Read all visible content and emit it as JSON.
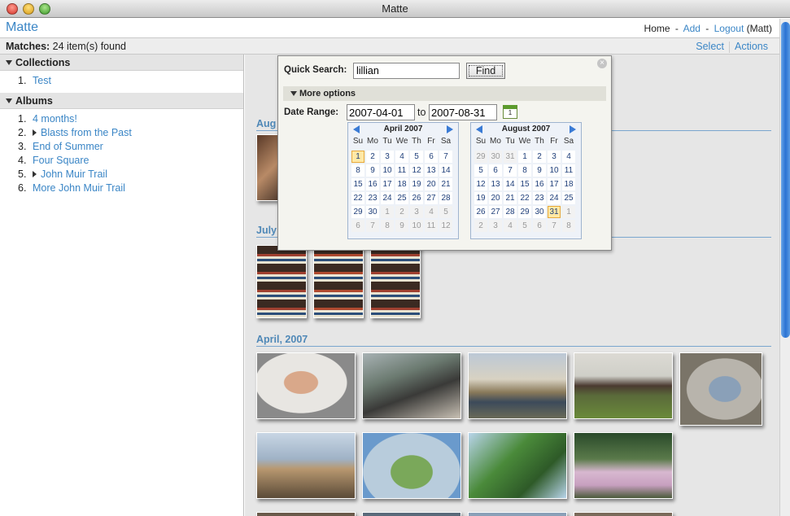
{
  "window": {
    "title": "Matte"
  },
  "app": {
    "title": "Matte"
  },
  "topnav": {
    "home": "Home",
    "sep": "-",
    "add": "Add",
    "logout": "Logout",
    "user": "(Matt)"
  },
  "matches": {
    "label": "Matches:",
    "count_text": "24 item(s) found",
    "select": "Select",
    "actions": "Actions"
  },
  "sidebar": {
    "collections": {
      "title": "Collections",
      "items": [
        {
          "num": "1.",
          "label": "Test"
        }
      ]
    },
    "albums": {
      "title": "Albums",
      "items": [
        {
          "num": "1.",
          "label": "4 months!"
        },
        {
          "num": "2.",
          "label": "Blasts from the Past"
        },
        {
          "num": "3.",
          "label": "End of Summer"
        },
        {
          "num": "4.",
          "label": "Four Square"
        },
        {
          "num": "5.",
          "label": "John Muir Trail"
        },
        {
          "num": "6.",
          "label": "More John Muir Trail"
        }
      ]
    }
  },
  "groups": {
    "august": "Aug",
    "july": "July",
    "april": "April, 2007"
  },
  "search": {
    "quick_label": "Quick Search:",
    "query": "lillian",
    "find_label": "Find",
    "more_options": "More options",
    "date_range_label": "Date Range:",
    "date_from": "2007-04-01",
    "to_label": "to",
    "date_to": "2007-08-31",
    "calendar_icon": "calendar-icon",
    "close_icon": "close-icon"
  },
  "calendars": [
    {
      "title": "April 2007",
      "dow": [
        "Su",
        "Mo",
        "Tu",
        "We",
        "Th",
        "Fr",
        "Sa"
      ],
      "weeks": [
        [
          "1",
          "2",
          "3",
          "4",
          "5",
          "6",
          "7"
        ],
        [
          "8",
          "9",
          "10",
          "11",
          "12",
          "13",
          "14"
        ],
        [
          "15",
          "16",
          "17",
          "18",
          "19",
          "20",
          "21"
        ],
        [
          "22",
          "23",
          "24",
          "25",
          "26",
          "27",
          "28"
        ],
        [
          "29",
          "30",
          "1",
          "2",
          "3",
          "4",
          "5"
        ],
        [
          "6",
          "7",
          "8",
          "9",
          "10",
          "11",
          "12"
        ]
      ],
      "selected": "1"
    },
    {
      "title": "August 2007",
      "dow": [
        "Su",
        "Mo",
        "Tu",
        "We",
        "Th",
        "Fr",
        "Sa"
      ],
      "weeks": [
        [
          "29",
          "30",
          "31",
          "1",
          "2",
          "3",
          "4"
        ],
        [
          "5",
          "6",
          "7",
          "8",
          "9",
          "10",
          "11"
        ],
        [
          "12",
          "13",
          "14",
          "15",
          "16",
          "17",
          "18"
        ],
        [
          "19",
          "20",
          "21",
          "22",
          "23",
          "24",
          "25"
        ],
        [
          "26",
          "27",
          "28",
          "29",
          "30",
          "31",
          "1"
        ],
        [
          "2",
          "3",
          "4",
          "5",
          "6",
          "7",
          "8"
        ]
      ],
      "selected": "31"
    }
  ],
  "colors": {
    "link": "#3b86c6",
    "group_heading": "#4f88b7",
    "selected_day": "#ffe9a6"
  }
}
